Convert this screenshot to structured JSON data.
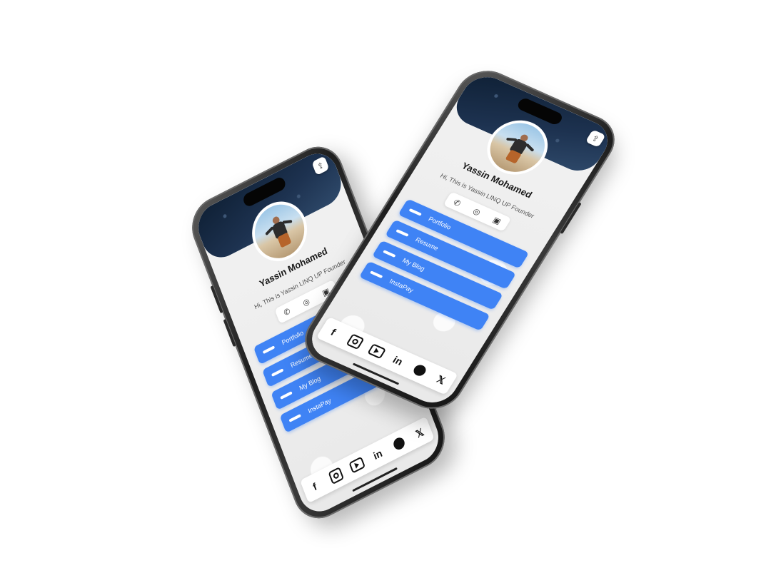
{
  "profile": {
    "name": "Yassin Mohamed",
    "bio": "Hi, This is Yassin LINQ UP Founder"
  },
  "contacts": {
    "phone_icon": "✆",
    "whatsapp_icon": "◎",
    "contact_icon": "▣"
  },
  "links": [
    {
      "label": "Portfolio"
    },
    {
      "label": "Resume"
    },
    {
      "label": "My Blog"
    },
    {
      "label": "InstaPay"
    }
  ],
  "social": {
    "facebook": "f",
    "linkedin": "in",
    "x": "𝕏"
  },
  "share_icon": "⇪",
  "colors": {
    "link_button": "#3f83f5",
    "banner": "#1d3250"
  }
}
